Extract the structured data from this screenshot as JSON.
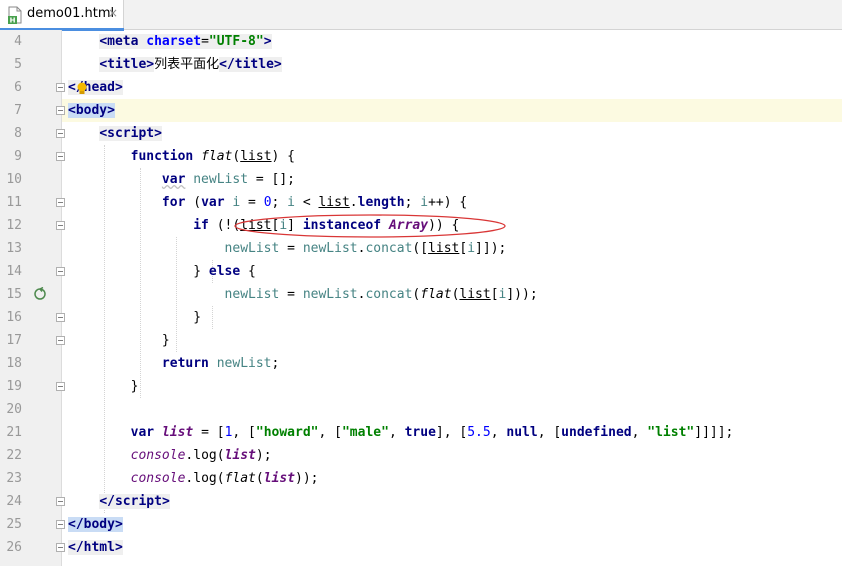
{
  "tab": {
    "filename": "demo01.html",
    "close_glyph": "×",
    "icon": "html-file-icon",
    "file_letter": "H",
    "accent": "#4b8ee0"
  },
  "editor": {
    "line_numbers": [
      "4",
      "5",
      "6",
      "7",
      "8",
      "9",
      "10",
      "11",
      "12",
      "13",
      "14",
      "15",
      "16",
      "17",
      "18",
      "19",
      "20",
      "21",
      "22",
      "23",
      "24",
      "25",
      "26"
    ],
    "current_line": "7",
    "annotation_color": "#d93636",
    "code": {
      "l4": [
        "<",
        "meta",
        " ",
        "charset",
        "=",
        "\"UTF-8\"",
        ">"
      ],
      "l5": [
        "<",
        "title",
        ">",
        "列表平面化",
        "</",
        "title",
        ">"
      ],
      "l6": [
        "</",
        "head",
        ">"
      ],
      "l7": [
        "<",
        "body",
        ">"
      ],
      "l8": [
        "<",
        "script",
        ">"
      ],
      "l9": [
        "function",
        " ",
        "flat",
        "(",
        "list",
        ") {"
      ],
      "l10": [
        "var",
        " ",
        "newList",
        " = [];"
      ],
      "l11": [
        "for",
        " (",
        "var",
        " ",
        "i",
        " = ",
        "0",
        "; ",
        "i",
        " < ",
        "list",
        ".",
        "length",
        "; ",
        "i",
        "++) {"
      ],
      "l12": [
        "if",
        " (!(",
        "list",
        "[",
        "i",
        "] ",
        "instanceof",
        " ",
        "Array",
        ")) {"
      ],
      "l13": [
        "newList",
        " = ",
        "newList",
        ".",
        "concat",
        "([",
        "list",
        "[",
        "i",
        "]]);"
      ],
      "l14": [
        "} ",
        "else",
        " {"
      ],
      "l15": [
        "newList",
        " = ",
        "newList",
        ".",
        "concat",
        "(",
        "flat",
        "(",
        "list",
        "[",
        "i",
        "]));"
      ],
      "l16": [
        "}"
      ],
      "l17": [
        "}"
      ],
      "l18": [
        "return",
        " ",
        "newList",
        ";"
      ],
      "l19": [
        "}"
      ],
      "l20": [
        ""
      ],
      "l21": [
        "var",
        " ",
        "list",
        " = [",
        "1",
        ", [",
        "\"howard\"",
        ", [",
        "\"male\"",
        ", ",
        "true",
        "], [",
        "5.5",
        ", ",
        "null",
        ", [",
        "undefined",
        ", ",
        "\"list\"",
        "]]]];"
      ],
      "l22": [
        "console",
        ".log(",
        "list",
        ");"
      ],
      "l23": [
        "console",
        ".log(",
        "flat",
        "(",
        "list",
        "));"
      ],
      "l24": [
        "</",
        "script",
        ">"
      ],
      "l25": [
        "</",
        "body",
        ">"
      ],
      "l26": [
        "</",
        "html",
        ">"
      ]
    }
  }
}
